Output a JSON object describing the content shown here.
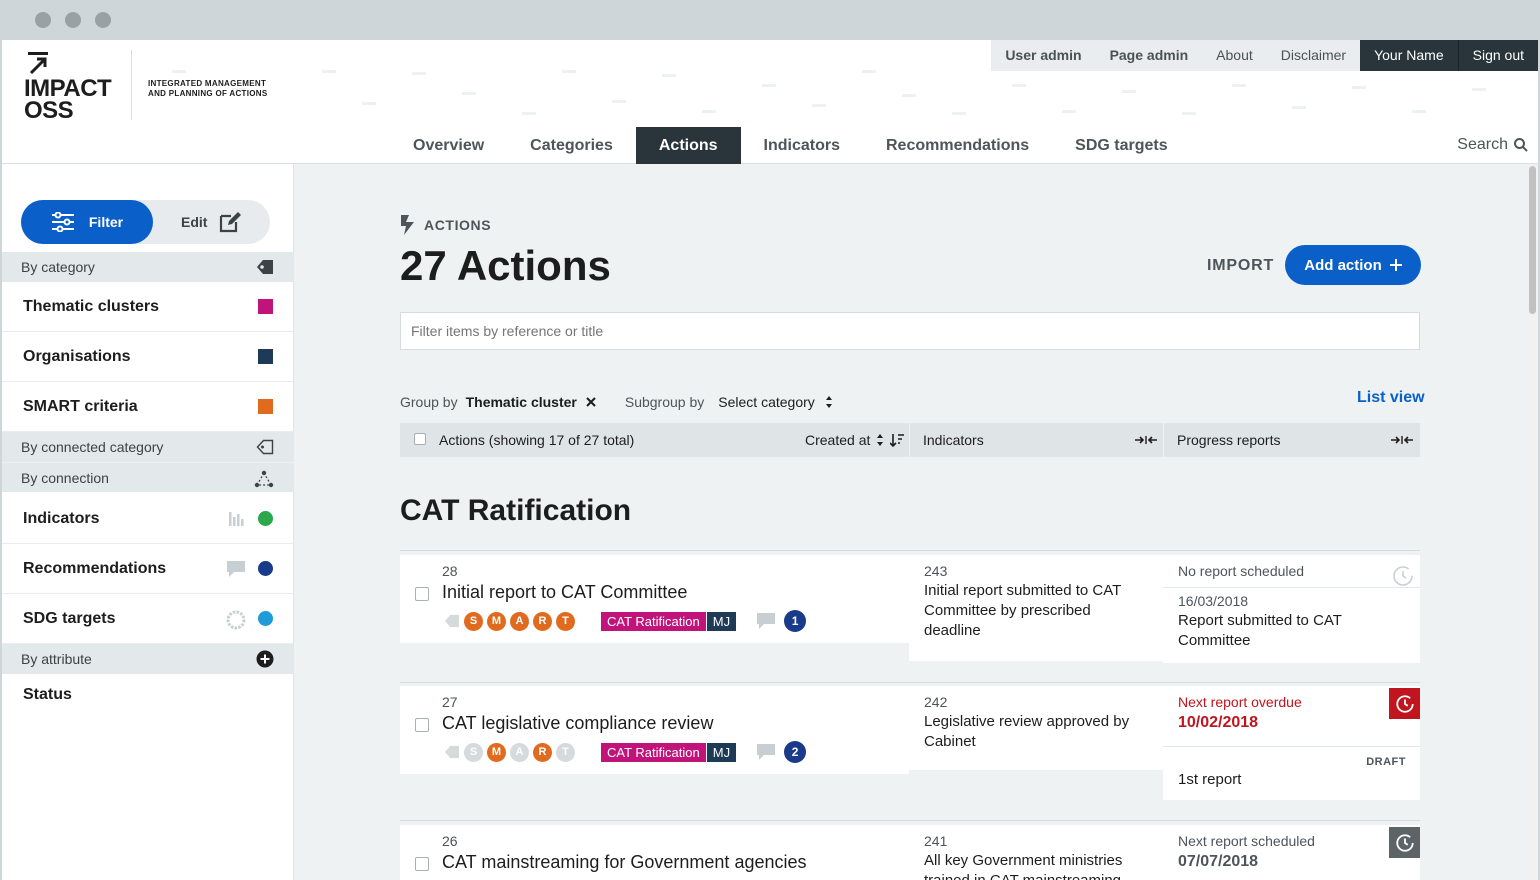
{
  "brand": {
    "logo_line1": "IMPACT",
    "logo_line2": "OSS",
    "claim_line1": "INTEGRATED MANAGEMENT",
    "claim_line2": "AND PLANNING OF ACTIONS"
  },
  "topnav": {
    "user_admin": "User admin",
    "page_admin": "Page admin",
    "about": "About",
    "disclaimer": "Disclaimer",
    "user_name": "Your Name",
    "sign_out": "Sign out"
  },
  "mainnav": {
    "items": [
      "Overview",
      "Categories",
      "Actions",
      "Indicators",
      "Recommendations",
      "SDG targets"
    ],
    "active": "Actions",
    "search_label": "Search"
  },
  "sidebar": {
    "filter_label": "Filter",
    "edit_label": "Edit",
    "by_category": "By category",
    "categories": [
      {
        "label": "Thematic clusters",
        "color": "#c0147b"
      },
      {
        "label": "Organisations",
        "color": "#1d3a57"
      },
      {
        "label": "SMART criteria",
        "color": "#e06b1f"
      }
    ],
    "by_connected_category": "By connected category",
    "by_connection": "By connection",
    "connections": [
      {
        "label": "Indicators",
        "color": "#2aa84a",
        "icon": "bar-chart-icon"
      },
      {
        "label": "Recommendations",
        "color": "#1a3a8a",
        "icon": "speech-bubble-icon"
      },
      {
        "label": "SDG targets",
        "color": "#1f9bd7",
        "icon": "sdg-wheel-icon"
      }
    ],
    "by_attribute": "By attribute",
    "attributes": [
      {
        "label": "Status"
      }
    ]
  },
  "main": {
    "section_label": "ACTIONS",
    "page_title": "27 Actions",
    "import_label": "IMPORT",
    "add_label": "Add action",
    "filter_placeholder": "Filter items by reference or title",
    "group_by_label": "Group by",
    "group_by_value": "Thematic cluster",
    "subgroup_by_label": "Subgroup by",
    "subgroup_by_value": "Select category",
    "list_view_label": "List view",
    "columns": {
      "actions": "Actions (showing 17 of 27 total)",
      "created_at": "Created at",
      "indicators": "Indicators",
      "progress_reports": "Progress reports"
    },
    "group_title": "CAT Ratification",
    "rows": [
      {
        "ref": "28",
        "title": "Initial report to CAT Committee",
        "smart": [
          {
            "letter": "S",
            "on": true
          },
          {
            "letter": "M",
            "on": true
          },
          {
            "letter": "A",
            "on": true
          },
          {
            "letter": "R",
            "on": true
          },
          {
            "letter": "T",
            "on": true
          }
        ],
        "cat_tag": "CAT Ratification",
        "org_tag": "MJ",
        "comment_count": "1",
        "indicator_ref": "243",
        "indicator_title": "Initial report submitted to CAT Committee by prescribed deadline",
        "report_status": "No report scheduled",
        "report_date": "16/03/2018",
        "report_title": "Report submitted to CAT Committee"
      },
      {
        "ref": "27",
        "title": "CAT legislative compliance review",
        "smart": [
          {
            "letter": "S",
            "on": false
          },
          {
            "letter": "M",
            "on": true
          },
          {
            "letter": "A",
            "on": false
          },
          {
            "letter": "R",
            "on": true
          },
          {
            "letter": "T",
            "on": false
          }
        ],
        "cat_tag": "CAT Ratification",
        "org_tag": "MJ",
        "comment_count": "2",
        "indicator_ref": "242",
        "indicator_title": "Legislative review approved by Cabinet",
        "report_status": "Next report overdue",
        "report_due": "10/02/2018",
        "report_draft": "DRAFT",
        "report_title": "1st report"
      },
      {
        "ref": "26",
        "title": "CAT mainstreaming for Government agencies",
        "indicator_ref": "241",
        "indicator_title": "All key Government ministries trained in CAT mainstreaming",
        "report_status": "Next report scheduled",
        "report_due": "07/07/2018"
      }
    ]
  },
  "colors": {
    "primary": "#0a60c8",
    "dark": "#29353a",
    "overdue": "#c0141e",
    "smart": "#e06b1f"
  }
}
